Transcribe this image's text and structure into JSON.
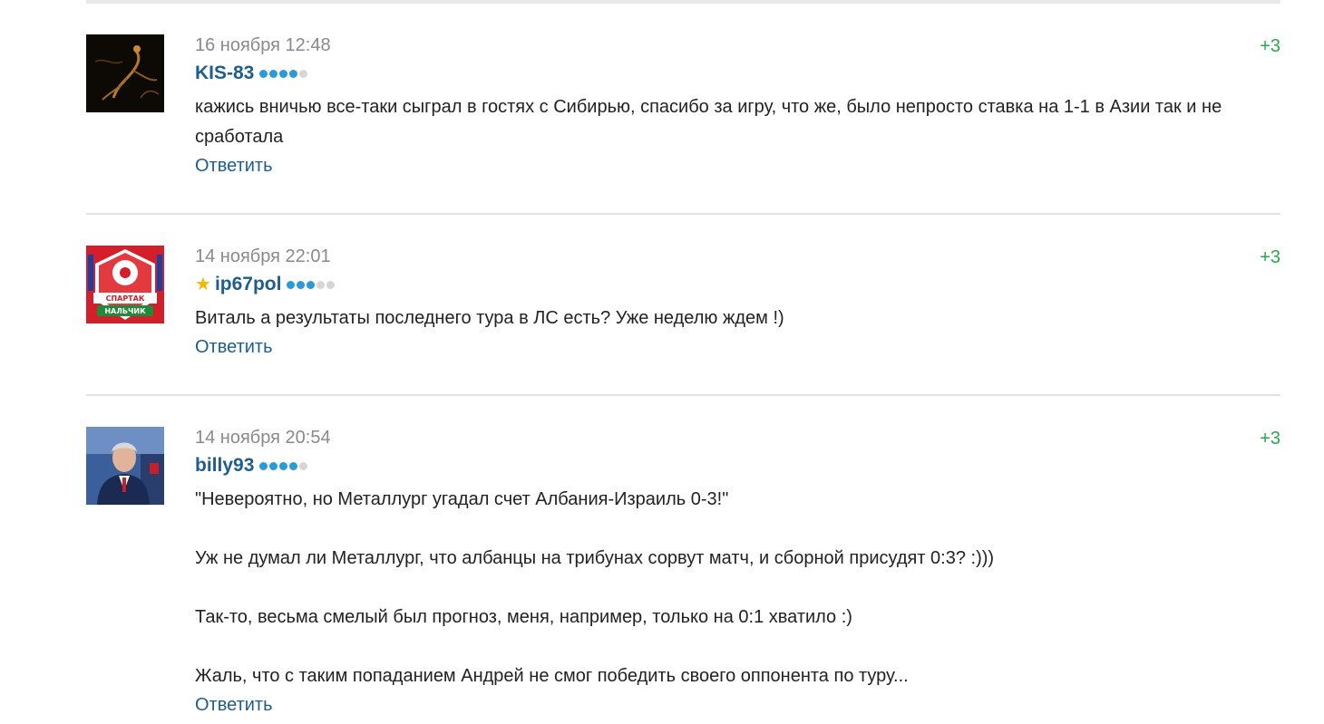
{
  "comments": [
    {
      "date": "16 ноября 12:48",
      "author": "KIS-83",
      "rank_dots": 4,
      "rating": "+3",
      "has_star": false,
      "avatar_icon": "dancer-silhouette-avatar",
      "text": [
        "кажись вничью все-таки сыграл в гостях с Сибирью, спасибо за игру, что же, было непросто ставка на 1-1 в Азии так и не сработала"
      ],
      "reply_label": "Ответить"
    },
    {
      "date": "14 ноября 22:01",
      "author": "ip67pol",
      "rank_dots": 3,
      "rating": "+3",
      "has_star": true,
      "avatar_icon": "spartak-nalchik-logo-avatar",
      "avatar_badge_top": "СПАРТАК",
      "avatar_badge_bottom": "НАЛЬЧИК",
      "text": [
        "Виталь а результаты последнего тура в ЛС есть? Уже неделю ждем !)"
      ],
      "reply_label": "Ответить"
    },
    {
      "date": "14 ноября 20:54",
      "author": "billy93",
      "rank_dots": 4,
      "rating": "+3",
      "has_star": false,
      "avatar_icon": "coach-photo-avatar",
      "text": [
        "\"Невероятно, но Металлург угадал счет Албания-Израиль 0-3!\"",
        "Уж не думал ли Металлург, что албанцы на трибунах сорвут матч, и сборной присудят 0:3? :)))",
        "Так-то, весьма смелый был прогноз, меня, например, только на 0:1 хватило :)",
        "Жаль, что с таким попаданием Андрей не смог победить своего оппонента по туру..."
      ],
      "reply_label": "Ответить"
    }
  ],
  "colors": {
    "author": "#1e5d8c",
    "rating": "#2aa84a",
    "dot_active": "#2b9bd8",
    "dot_inactive": "#d6d6d6",
    "date": "#8a8a8a",
    "star": "#f5b800"
  }
}
